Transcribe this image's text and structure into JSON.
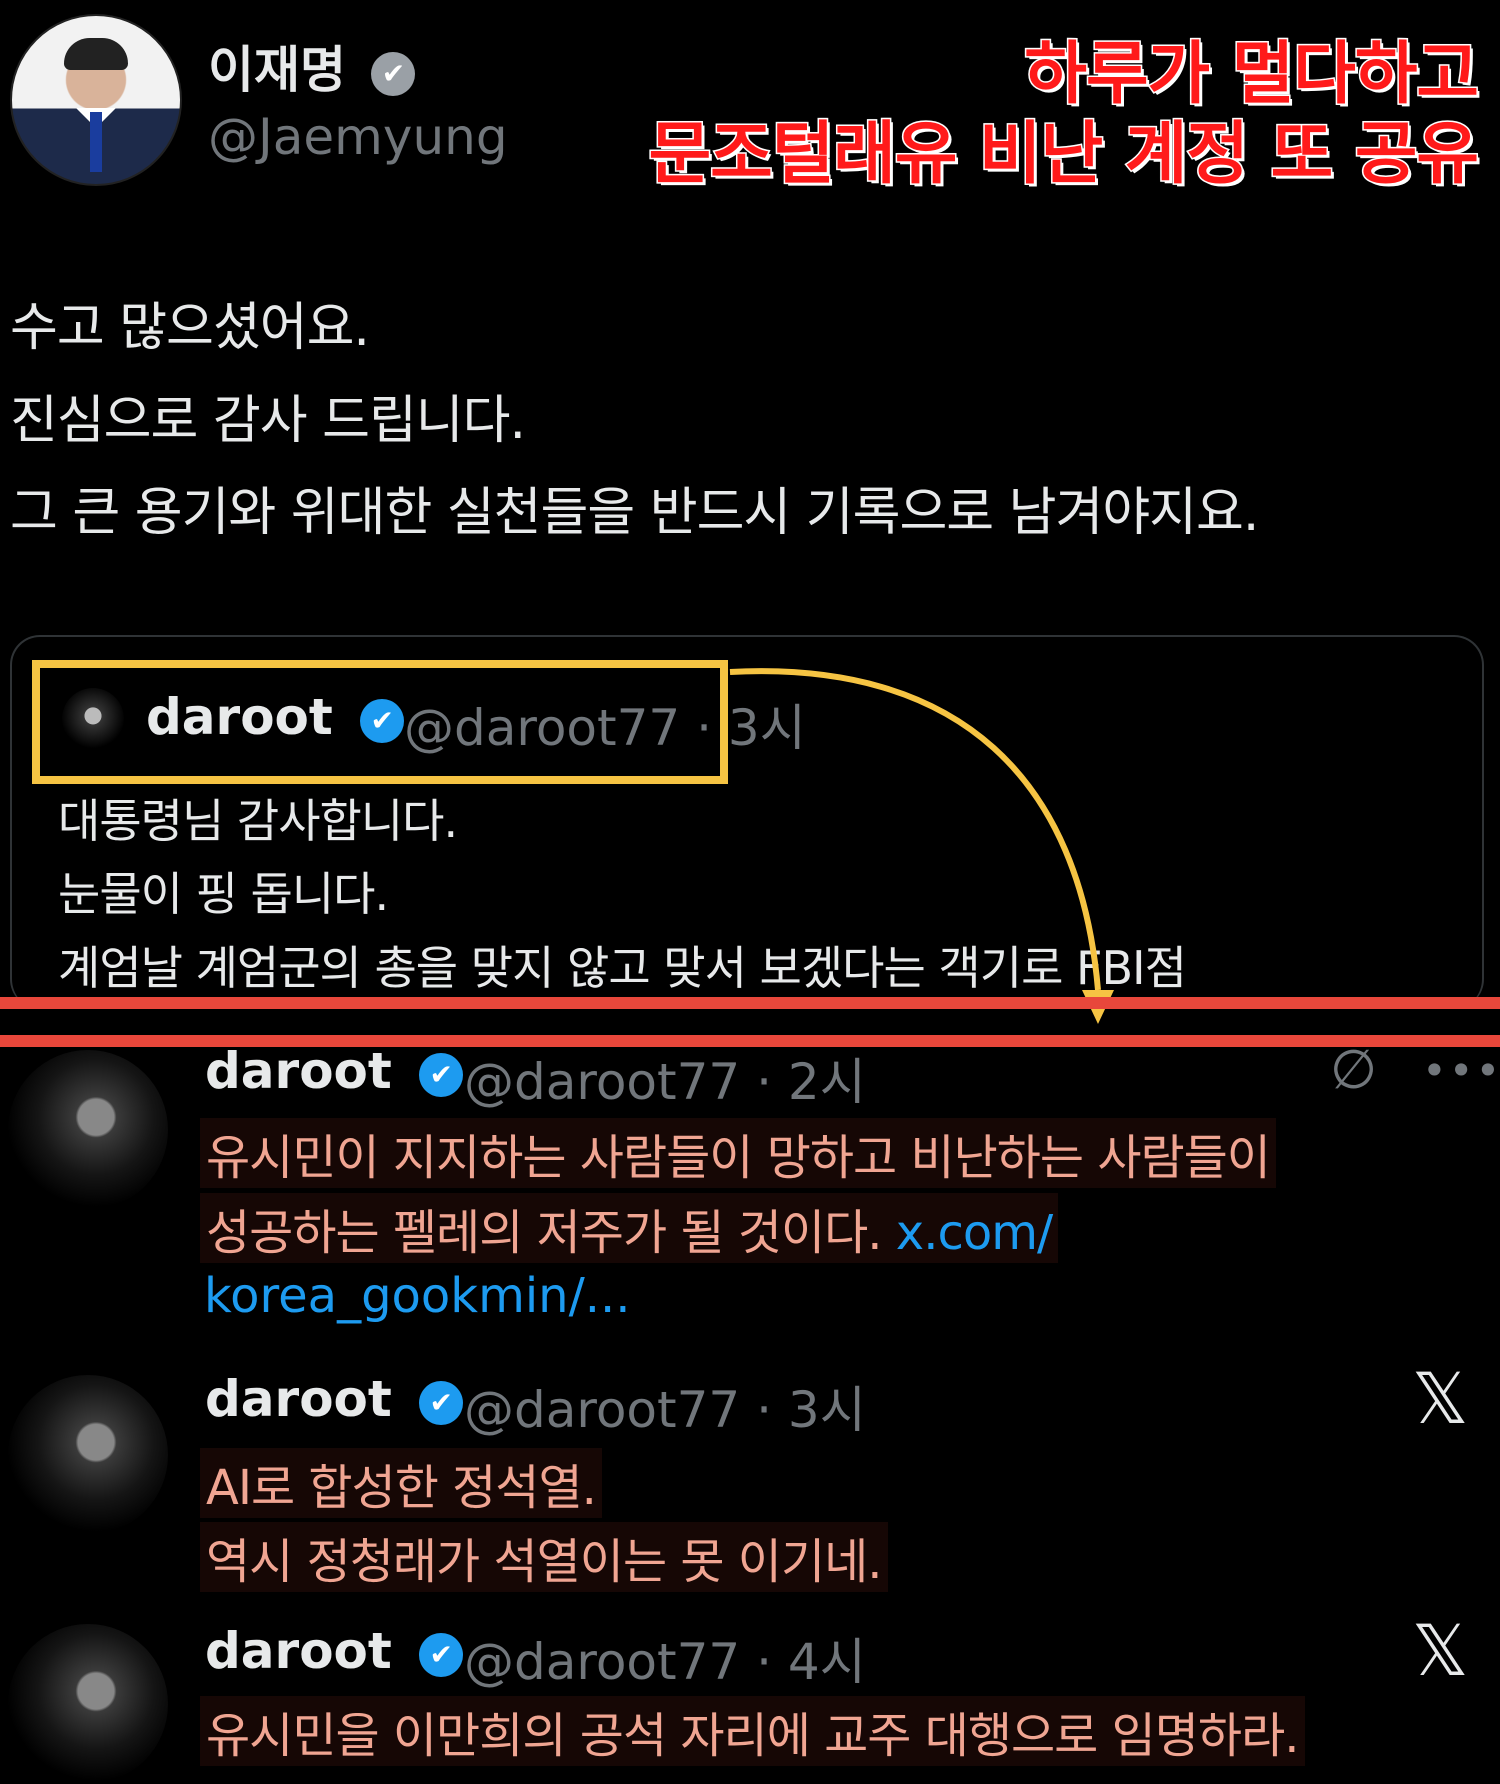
{
  "header": {
    "name": "이재명",
    "handle": "@Jaemyung",
    "verified_icon": "verified-badge-grey"
  },
  "banner": {
    "line1": "하루가 멀다하고",
    "line2": "문조털래유 비난 계정 또 공유",
    "color": "#ff1a1a"
  },
  "tweet": {
    "lines": [
      "수고 많으셨어요.",
      "진심으로 감사 드립니다.",
      "그 큰 용기와 위대한 실천들을 반드시 기록으로 남겨야지요."
    ]
  },
  "quote": {
    "name": "daroot",
    "handle": "@daroot77 · 3시",
    "lines": [
      "대통령님 감사합니다.",
      "눈물이 핑 돕니다.",
      "계엄날 계엄군의 총을 맞지 않고 맞서 보겠다는 객기로 FBI점"
    ]
  },
  "feed": [
    {
      "name": "daroot",
      "handle": "@daroot77 · 2시",
      "lines": [
        "유시민이 지지하는 사람들이 망하고 비난하는 사람들이",
        "성공하는 펠레의 저주가 될 것이다."
      ],
      "link_inline": "x.com/",
      "link_next": "korea_gookmin/..."
    },
    {
      "name": "daroot",
      "handle": "@daroot77 · 3시",
      "lines": [
        "AI로 합성한 정석열.",
        "역시 정청래가 석열이는 못 이기네."
      ]
    },
    {
      "name": "daroot",
      "handle": "@daroot77 · 4시",
      "lines": [
        "유시민을 이만희의 공석 자리에 교주 대행으로 임명하라."
      ]
    }
  ],
  "icons": {
    "verified": "✔",
    "x_logo": "𝕏",
    "more": "•••",
    "grok": "∅"
  },
  "colors": {
    "highlight_box": "#f6c443",
    "divider": "#e8473b",
    "link": "#1d9bf0"
  }
}
